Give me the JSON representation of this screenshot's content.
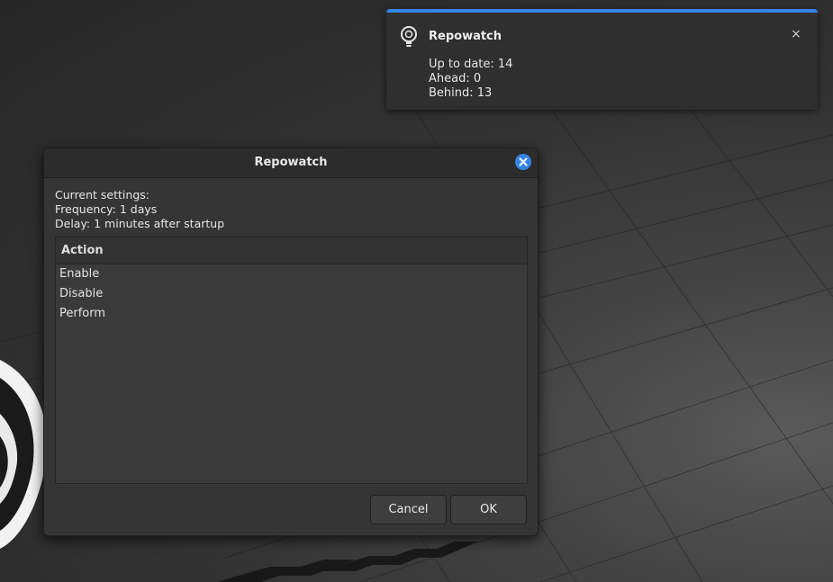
{
  "notification": {
    "icon": "lightbulb-icon",
    "title": "Repowatch",
    "lines": [
      "Up to date: 14",
      "Ahead: 0",
      "Behind: 13"
    ],
    "close_glyph": "×",
    "accent_color": "#3584e4"
  },
  "dialog": {
    "title": "Repowatch",
    "close_icon": "close-icon",
    "info_lines": [
      "Current settings:",
      "Frequency: 1 days",
      "Delay: 1 minutes after startup"
    ],
    "list_header": "Action",
    "actions": [
      "Enable",
      "Disable",
      "Perform"
    ],
    "cancel_label": "Cancel",
    "ok_label": "OK"
  }
}
